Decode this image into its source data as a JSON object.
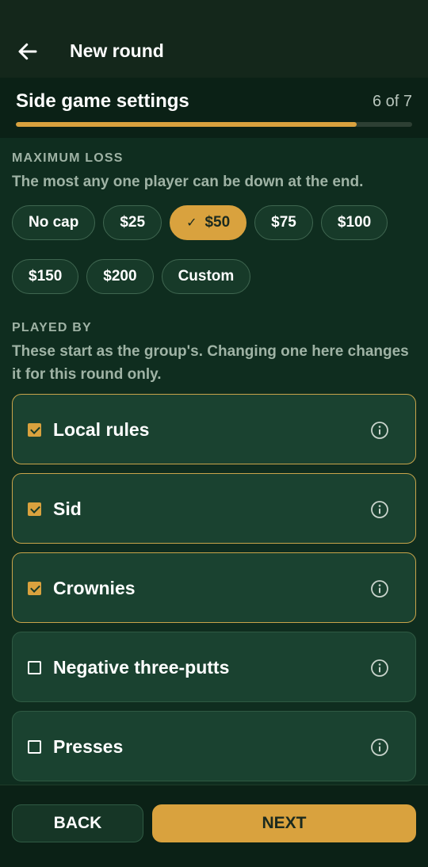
{
  "header": {
    "title": "New round",
    "back_icon": "arrow-left-icon"
  },
  "step": {
    "title": "Side game settings",
    "count": "6 of 7",
    "progress": 0.86
  },
  "max_loss": {
    "label": "MAXIMUM LOSS",
    "description": "The most any one player can be down at the end.",
    "options": [
      "No cap",
      "$25",
      "$50",
      "$75",
      "$100",
      "$150",
      "$200",
      "Custom"
    ],
    "selected": "$50"
  },
  "played_by": {
    "label": "PLAYED BY",
    "description": "These start as the group's. Changing one here changes it for this round only.",
    "rules": [
      {
        "label": "Local rules",
        "checked": true
      },
      {
        "label": "Sid",
        "checked": true
      },
      {
        "label": "Crownies",
        "checked": true
      },
      {
        "label": "Negative three-putts",
        "checked": false
      },
      {
        "label": "Presses",
        "checked": false
      }
    ]
  },
  "footer": {
    "back_label": "BACK",
    "next_label": "NEXT"
  },
  "colors": {
    "accent": "#d9a23e",
    "background": "#0f2d1f",
    "card": "#1a4230"
  }
}
